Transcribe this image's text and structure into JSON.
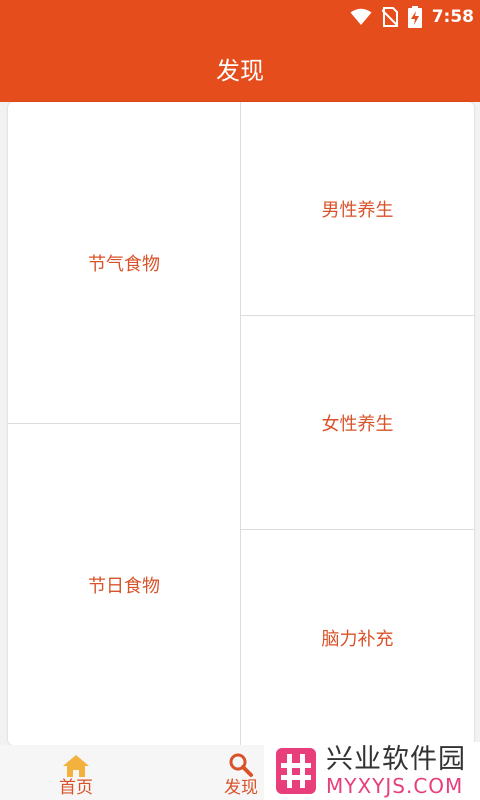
{
  "status_bar": {
    "time": "7:58",
    "icons": [
      "wifi-icon",
      "no-sim-icon",
      "battery-charging-icon"
    ]
  },
  "header": {
    "title": "发现"
  },
  "grid": {
    "tiles": [
      {
        "label": "节气食物"
      },
      {
        "label": "节日食物"
      },
      {
        "label": "男性养生"
      },
      {
        "label": "女性养生"
      },
      {
        "label": "脑力补充"
      }
    ]
  },
  "bottom_nav": {
    "items": [
      {
        "label": "首页",
        "icon": "home-icon"
      },
      {
        "label": "发现",
        "icon": "search-icon"
      }
    ]
  },
  "watermark": {
    "title": "兴业软件园",
    "subtitle": "MYXYJS.COM",
    "icon": "hash-logo-icon"
  },
  "colors": {
    "accent": "#e54d1c",
    "tile_text": "#d9532a",
    "home_icon": "#f3b13d",
    "watermark_pink": "#e83e7c"
  }
}
